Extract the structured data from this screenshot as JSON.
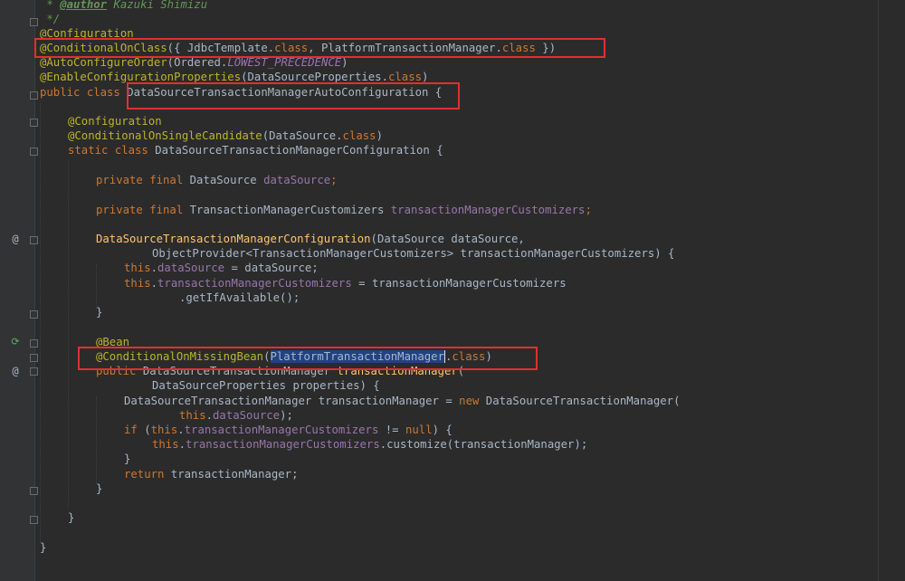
{
  "code": {
    "l1": {
      "a": " * ",
      "b": "@author",
      "c": " Kazuki Shimizu"
    },
    "l2": {
      "a": " */"
    },
    "l3": {
      "a": "@Configuration"
    },
    "l4": {
      "a": "@ConditionalOnClass",
      "b": "({ JdbcTemplate.",
      "c": "class",
      ".d": "",
      "d": ", PlatformTransactionManager.",
      "e": "class",
      "f": " })"
    },
    "l5": {
      "a": "@AutoConfigureOrder",
      "b": "(Ordered.",
      "c": "LOWEST_PRECEDENCE",
      "d": ")"
    },
    "l6": {
      "a": "@EnableConfigurationProperties",
      "b": "(DataSourceProperties.",
      "c": "class",
      "d": ")"
    },
    "l7": {
      "a": "public class ",
      "b": "DataSourceTransactionManagerAutoConfiguration {"
    },
    "l8": {
      "a": "@Configuration"
    },
    "l9": {
      "a": "@ConditionalOnSingleCandidate",
      "b": "(DataSource.",
      "c": "class",
      "d": ")"
    },
    "l10": {
      "a": "static class ",
      "b": "DataSourceTransactionManagerConfiguration {"
    },
    "l11": {
      "a": "private final ",
      "b": "DataSource ",
      "c": "dataSource",
      "d": ";"
    },
    "l12": {
      "a": "private final ",
      "b": "TransactionManagerCustomizers ",
      "c": "transactionManagerCustomizers",
      "d": ";"
    },
    "l13": {
      "a": "DataSourceTransactionManagerConfiguration",
      "b": "(DataSource dataSource,"
    },
    "l14": {
      "a": "ObjectProvider<TransactionManagerCustomizers> transactionManagerCustomizers) {"
    },
    "l15": {
      "a": "this",
      ".b": "",
      "b": ".",
      "c": "dataSource",
      "d": " = dataSource;"
    },
    "l16": {
      "a": "this",
      "b": ".",
      "c": "transactionManagerCustomizers",
      "d": " = transactionManagerCustomizers"
    },
    "l17": {
      "a": ".getIfAvailable();"
    },
    "l18": {
      "a": "}"
    },
    "l19": {
      "a": "@Bean"
    },
    "l20": {
      "a": "@ConditionalOnMissingBean",
      "b": "(",
      "c": "PlatformTransactionManager",
      "d": ".",
      "e": "class",
      "f": ")"
    },
    "l21": {
      "a": "public ",
      "b": "DataSourceTransactionManager ",
      "c": "transactionManager",
      "d": "("
    },
    "l22": {
      "a": "DataSourceProperties properties) {"
    },
    "l23": {
      "a": "DataSourceTransactionManager transactionManager = ",
      "b": "new ",
      "c": "DataSourceTransactionManager("
    },
    "l24": {
      "a": "this",
      "b": ".",
      "c": "dataSource",
      "d": ");"
    },
    "l25": {
      "a": "if ",
      "b": "(",
      "c": "this",
      "d": ".",
      "e": "transactionManagerCustomizers",
      "f": " != ",
      "g": "null",
      "h": ") {"
    },
    "l26": {
      "a": "this",
      "b": ".",
      "c": "transactionManagerCustomizers",
      "d": ".customize(transactionManager);"
    },
    "l27": {
      "a": "}"
    },
    "l28": {
      "a": "return ",
      "b": "transactionManager;"
    },
    "l29": {
      "a": "}"
    },
    "l30": {
      "a": "}"
    },
    "l31": {
      "a": "}"
    }
  },
  "gutter_icons": {
    "override1": "@",
    "bean": "⟳",
    "override2": "@"
  },
  "colors": {
    "background": "#2b2b2b",
    "annotation": "#bbb529",
    "keyword": "#cc7832",
    "field": "#9876aa",
    "method": "#ffc66d",
    "highlight_box": "#e03030",
    "selection": "#214283"
  }
}
